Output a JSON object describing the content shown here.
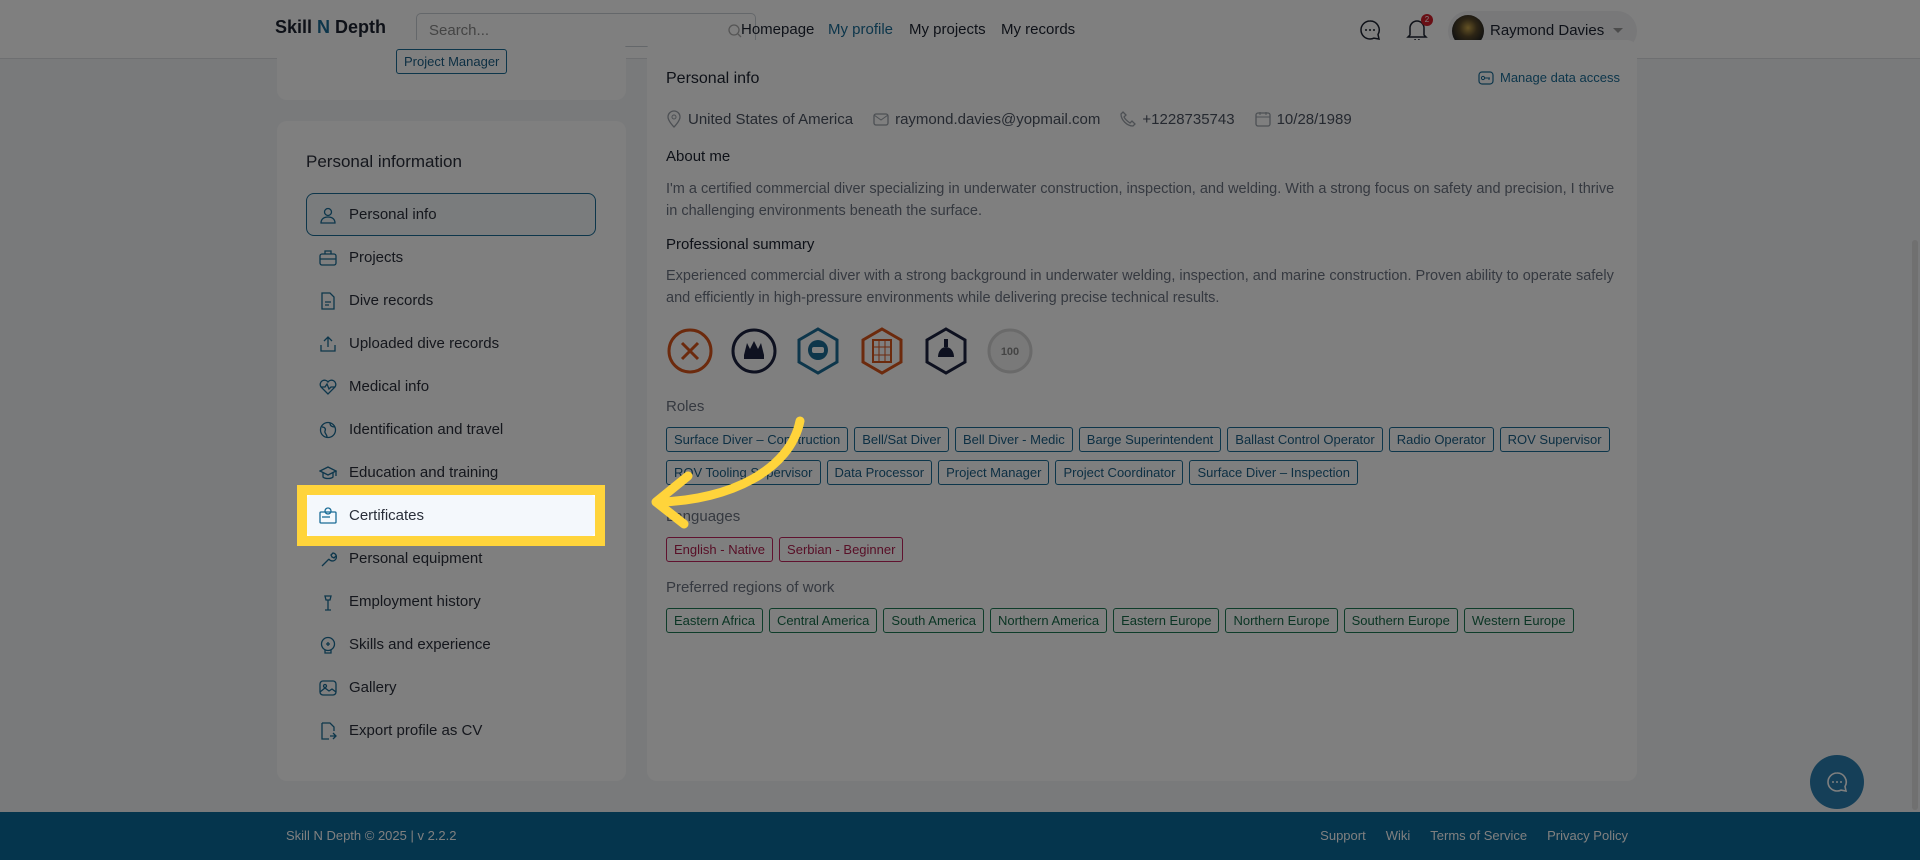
{
  "header": {
    "logo_a": "Skill ",
    "logo_n": "N",
    "logo_b": " Depth",
    "search_placeholder": "Search...",
    "nav": [
      "Homepage",
      "My profile",
      "My projects",
      "My records"
    ],
    "notifications_count": "2",
    "user_name": "Raymond Davies"
  },
  "top_card": {
    "tag": "Project Manager"
  },
  "sidebar": {
    "title": "Personal information",
    "items": [
      "Personal info",
      "Projects",
      "Dive records",
      "Uploaded dive records",
      "Medical info",
      "Identification and travel",
      "Education and training",
      "Certificates",
      "Personal equipment",
      "Employment history",
      "Skills and experience",
      "Gallery",
      "Export profile as CV"
    ]
  },
  "main": {
    "title": "Personal info",
    "manage_label": "Manage data access",
    "country": "United States of America",
    "email": "raymond.davies@yopmail.com",
    "phone": "+1228735743",
    "birthdate": "10/28/1989",
    "about_title": "About me",
    "about": "I'm a certified commercial diver specializing in underwater construction, inspection, and welding. With a strong focus on safety and precision, I thrive in challenging environments beneath the surface.",
    "summary_title": "Professional summary",
    "summary": "Experienced commercial diver with a strong background in underwater welding, inspection, and marine construction. Proven ability to operate safely and efficiently in high-pressure environments while delivering precise technical results.",
    "badge_100": "100",
    "roles_title": "Roles",
    "roles": [
      "Surface Diver – Construction",
      "Bell/Sat Diver",
      "Bell Diver - Medic",
      "Barge Superintendent",
      "Ballast Control Operator",
      "Radio Operator",
      "ROV Supervisor",
      "ROV Tooling Supervisor",
      "Data Processor",
      "Project Manager",
      "Project Coordinator",
      "Surface Diver – Inspection"
    ],
    "languages_title": "Languages",
    "languages": [
      "English - Native",
      "Serbian - Beginner"
    ],
    "regions_title": "Preferred regions of work",
    "regions": [
      "Eastern Africa",
      "Central America",
      "South America",
      "Northern America",
      "Eastern Europe",
      "Northern Europe",
      "Southern Europe",
      "Western Europe"
    ]
  },
  "footer": {
    "copyright": "Skill N Depth © 2025 | v 2.2.2",
    "links": [
      "Support",
      "Wiki",
      "Terms of Service",
      "Privacy Policy"
    ]
  },
  "colors": {
    "accent": "#1a6c96",
    "highlight": "#ffd43b"
  }
}
